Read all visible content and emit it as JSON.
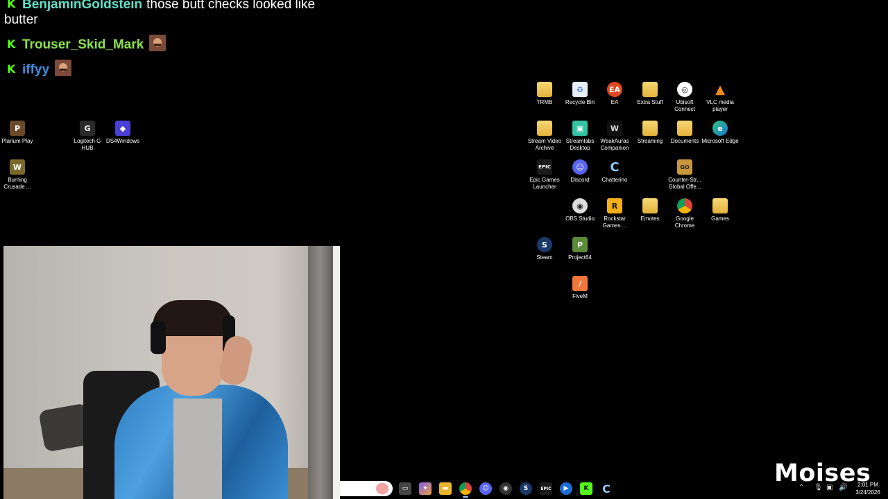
{
  "chat": [
    {
      "username": "BenjaminGoldstein",
      "color": "#5ee0c9",
      "message": "those butt checks looked like butter",
      "emote": false
    },
    {
      "username": "Trouser_Skid_Mark",
      "color": "#8be34a",
      "message": "",
      "emote": true
    },
    {
      "username": "iffyy",
      "color": "#3d8fe3",
      "message": "",
      "emote": true
    }
  ],
  "left_icons": [
    {
      "label": "Plarium Play",
      "icon": "plarium-icon"
    },
    {
      "label": "Logitech G HUB",
      "icon": "logitech-icon"
    },
    {
      "label": "DS4Windows",
      "icon": "gamepad-icon"
    },
    {
      "label": "Burning Crusade ...",
      "icon": "wow-icon"
    }
  ],
  "right_icons": [
    {
      "label": "TRMB",
      "icon": "folder-icon"
    },
    {
      "label": "Recycle Bin",
      "icon": "recycle-bin-icon"
    },
    {
      "label": "EA",
      "icon": "ea-icon"
    },
    {
      "label": "Extra Stuff",
      "icon": "folder-icon"
    },
    {
      "label": "Ubisoft Connect",
      "icon": "ubisoft-icon"
    },
    {
      "label": "VLC media player",
      "icon": "vlc-icon"
    },
    {
      "label": "Stream Video Archive",
      "icon": "folder-icon"
    },
    {
      "label": "Streamlabs Desktop",
      "icon": "streamlabs-icon"
    },
    {
      "label": "WeakAuras Companion",
      "icon": "weakauras-icon"
    },
    {
      "label": "Streaming",
      "icon": "folder-icon"
    },
    {
      "label": "Documents",
      "icon": "folder-icon"
    },
    {
      "label": "Microsoft Edge",
      "icon": "edge-icon"
    },
    {
      "label": "Epic Games Launcher",
      "icon": "epic-icon"
    },
    {
      "label": "Discord",
      "icon": "discord-icon"
    },
    {
      "label": "Chatterino",
      "icon": "chatterino-icon"
    },
    {
      "label": "Counter-Str... Global Offe...",
      "icon": "csgo-icon"
    },
    {
      "label": "OBS Studio",
      "icon": "obs-icon"
    },
    {
      "label": "Rockstar Games ...",
      "icon": "rockstar-icon"
    },
    {
      "label": "Emotes",
      "icon": "folder-icon"
    },
    {
      "label": "Google Chrome",
      "icon": "chrome-icon"
    },
    {
      "label": "Games",
      "icon": "folder-icon"
    },
    {
      "label": "Steam",
      "icon": "steam-icon"
    },
    {
      "label": "Project64",
      "icon": "project64-icon"
    },
    {
      "label": "FiveM",
      "icon": "fivem-icon"
    }
  ],
  "taskbar": {
    "apps": [
      "task-view-icon",
      "copilot-icon",
      "file-explorer-icon",
      "chrome-icon",
      "discord-icon",
      "obs-icon",
      "steam-icon",
      "epic-icon",
      "app-icon",
      "kick-icon",
      "chatterino-icon"
    ],
    "time": "2:01 PM",
    "date": "3/24/2026"
  },
  "watermark": "Moises"
}
